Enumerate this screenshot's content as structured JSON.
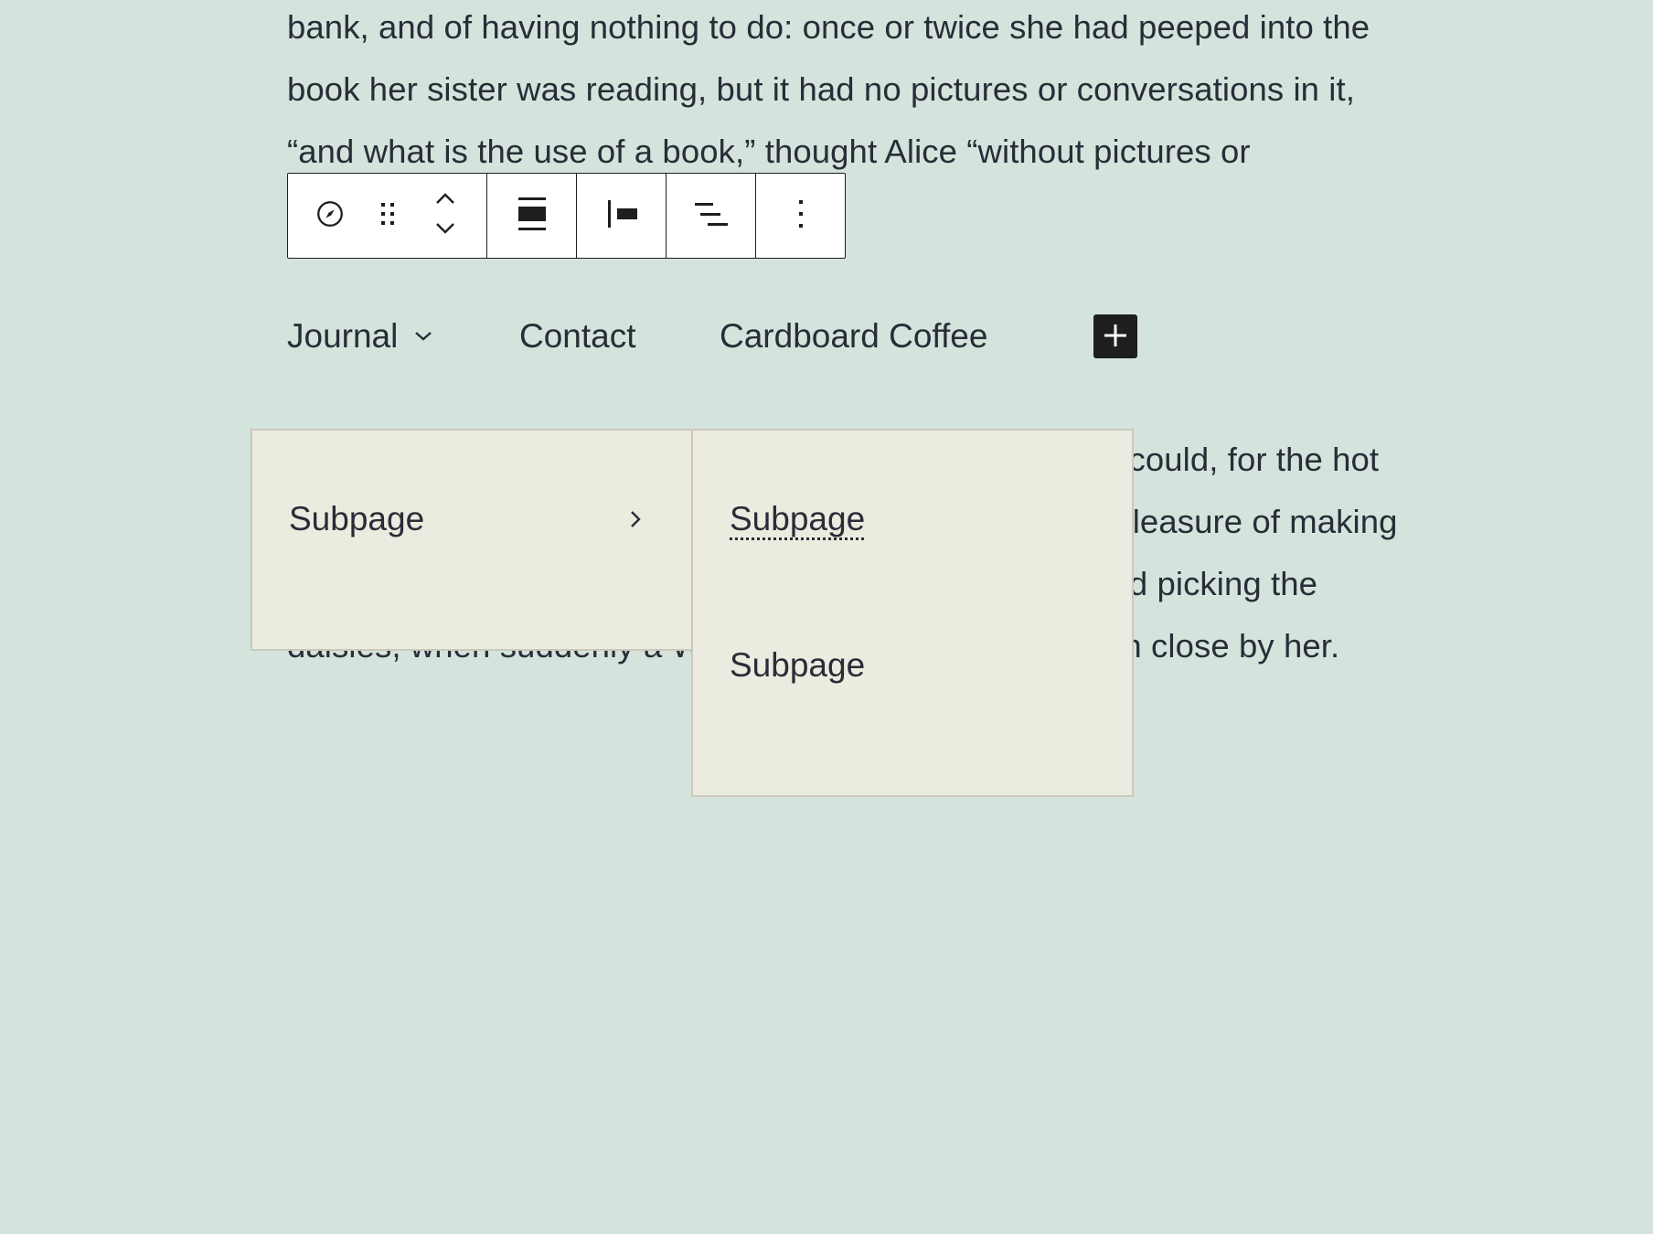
{
  "paragraphs": {
    "p1": "bank, and of having nothing to do: once or twice she had peeped into the book her sister was reading, but it had no pictures or conversations in it, “and what is the use of a book,” thought Alice “without pictures or conversations?”",
    "p2": "So she was considering in her own mind (as well as she could, for the hot day made her feel very sleepy and stupid), whether the pleasure of making a daisy-chain would be worth the trouble of getting up and picking the daisies, when suddenly a White Rabbit with pink eyes ran close by her."
  },
  "toolbar": {
    "buttons": [
      {
        "name": "navigation-block",
        "icon": "compass-icon"
      },
      {
        "name": "drag-handle",
        "icon": "drag-dots-icon"
      },
      {
        "name": "move-up",
        "icon": "chevron-up-icon"
      },
      {
        "name": "move-down",
        "icon": "chevron-down-icon"
      },
      {
        "name": "align",
        "icon": "align-wide-icon"
      },
      {
        "name": "justify",
        "icon": "justify-left-icon"
      },
      {
        "name": "text-align",
        "icon": "align-lines-icon"
      },
      {
        "name": "options",
        "icon": "more-vertical-icon"
      }
    ]
  },
  "nav": {
    "items": [
      {
        "label": "Journal",
        "has_submenu": true
      },
      {
        "label": "Contact"
      },
      {
        "label": "Cardboard Coffee"
      }
    ],
    "add_button_icon": "plus-icon"
  },
  "submenu1": {
    "items": [
      {
        "label": "Subpage",
        "has_submenu": true
      }
    ]
  },
  "submenu2": {
    "items": [
      {
        "label": "Subpage"
      },
      {
        "label": "Subpage"
      }
    ]
  },
  "colors": {
    "background": "#d4e3dc",
    "text": "#282d37",
    "menu_bg": "#ecebdf",
    "menu_border": "#cbc8bc",
    "toolbar_border": "#1e1e1e",
    "add_button_bg": "#1e1e1e"
  }
}
